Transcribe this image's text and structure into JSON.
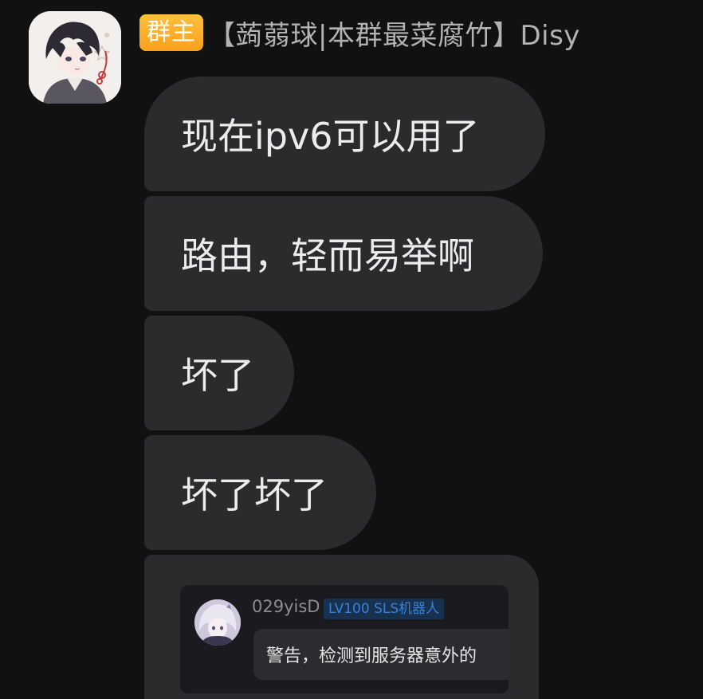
{
  "message_group": {
    "sender": {
      "role_badge": "群主",
      "name": "【蒟蒻球|本群最菜腐竹】Disy",
      "avatar_icon": "anime-boy-avatar-icon"
    },
    "messages": [
      {
        "text": "现在ipv6可以用了"
      },
      {
        "text": "路由，轻而易举啊"
      },
      {
        "text": "坏了"
      },
      {
        "text": "坏了坏了"
      }
    ],
    "forwarded": {
      "avatar_icon": "anime-girl-avatar-icon",
      "name": "029yisD",
      "tag": "LV100 SLS机器人",
      "text": "警告，检测到服务器意外的"
    }
  },
  "colors": {
    "background": "#111111",
    "bubble": "#2b2b2d",
    "badge": "#f9a11c",
    "tag_text": "#3d7fd4"
  }
}
